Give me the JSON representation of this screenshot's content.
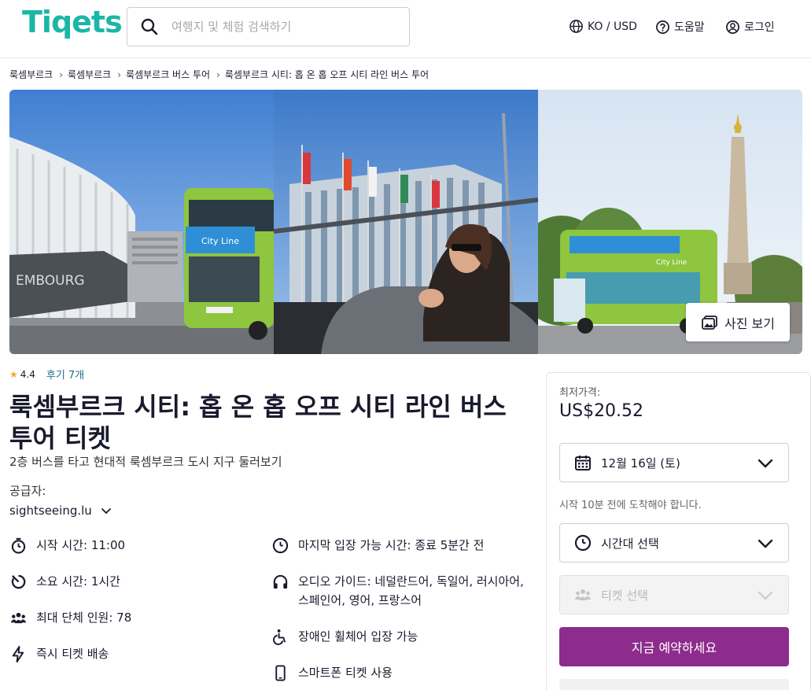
{
  "header": {
    "logo": "Tiqets",
    "search_placeholder": "여행지 및 체험 검색하기",
    "locale": "KO / USD",
    "help": "도움말",
    "login": "로그인"
  },
  "breadcrumb": [
    "룩셈부르크",
    "룩셈부르크",
    "룩셈부르크 버스 투어",
    "룩셈부르크 시티: 홉 온 홉 오프 시티 라인 버스 투어"
  ],
  "gallery": {
    "bus_sign_1": "City Line",
    "bus_sign_2": "City Line",
    "building_text": "EMBOURG",
    "view_photos": "사진 보기"
  },
  "product": {
    "rating": "4.4",
    "reviews": "후기 7개",
    "title": "룩셈부르크 시티: 홉 온 홉 오프 시티 라인 버스 투어 티켓",
    "subtitle": "2층 버스를 타고 현대적 룩셈부르크 도시 지구 둘러보기",
    "supplier_label": "공급자:",
    "supplier": "sightseeing.lu",
    "features_left": [
      {
        "icon": "stopwatch-icon",
        "label": "시작 시간:",
        "value": "11:00"
      },
      {
        "icon": "timer-icon",
        "label": "소요 시간:",
        "value": "1시간"
      },
      {
        "icon": "group-icon",
        "label": "최대 단체 인원:",
        "value": "78"
      },
      {
        "icon": "lightning-icon",
        "label": "즉시 티켓 배송",
        "value": ""
      }
    ],
    "features_right": [
      {
        "icon": "clock-icon",
        "label": "마지막 입장 가능 시간:",
        "value": "종료 5분간 전"
      },
      {
        "icon": "headphones-icon",
        "label": "오디오 가이드:",
        "value": "네덜란드어, 독일어, 러시아어, 스페인어, 영어, 프랑스어"
      },
      {
        "icon": "wheelchair-icon",
        "label": "장애인 휠체어 입장 가능",
        "value": ""
      },
      {
        "icon": "smartphone-icon",
        "label": "스마트폰 티켓 사용",
        "value": ""
      }
    ]
  },
  "booking": {
    "price_label": "최저가격:",
    "price": "US$20.52",
    "date": "12월 16일 (토)",
    "note": "시작 10분 전에 도착해야 합니다.",
    "timeslot": "시간대 선택",
    "ticket": "티켓 선택",
    "book_button": "지금 예약하세요"
  },
  "colors": {
    "brand": "#1bb6a8",
    "book_button": "#8d2c8c",
    "link": "#1f6f8b",
    "star": "#f5a623"
  }
}
